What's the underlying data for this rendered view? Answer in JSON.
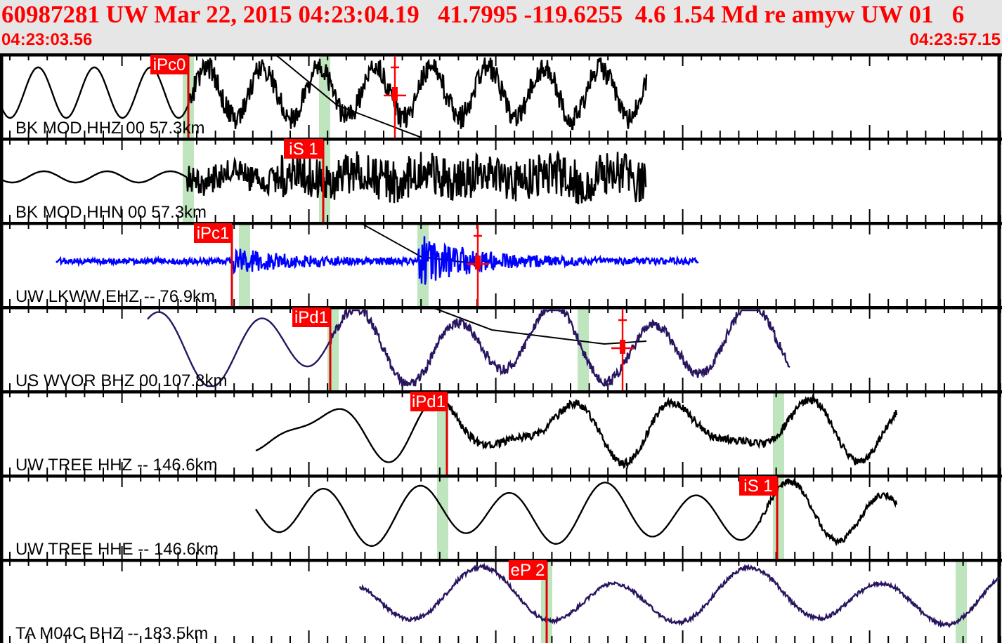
{
  "header": {
    "title": "60987281 UW Mar 22, 2015 04:23:04.19   41.7995 -119.6255  4.6 1.54 Md re amyw UW 01   6",
    "start_time": "04:23:03.56",
    "end_time": "04:23:57.15"
  },
  "traces": [
    {
      "label": "BK MOD HHZ 00 57.3km",
      "color": "#000000",
      "picks": [
        {
          "label": "iPc0"
        }
      ]
    },
    {
      "label": "BK MOD HHN 00 57.3km",
      "color": "#000000",
      "picks": [
        {
          "label": "iS 1"
        }
      ]
    },
    {
      "label": "UW LKWW EHZ -- 76.9km",
      "color": "#0000ff",
      "picks": [
        {
          "label": "iPc1"
        }
      ]
    },
    {
      "label": "US WVOR BHZ 00 107.8km",
      "color": "#2a1660",
      "picks": [
        {
          "label": "iPd1"
        }
      ]
    },
    {
      "label": "UW TREE HHZ -- 146.6km",
      "color": "#000000",
      "picks": [
        {
          "label": "iPd1"
        }
      ]
    },
    {
      "label": "UW TREE HHE -- 146.6km",
      "color": "#000000",
      "picks": [
        {
          "label": "iS 1"
        }
      ]
    },
    {
      "label": "TA M04C BHZ -- 183.5km",
      "color": "#2a1660",
      "picks": [
        {
          "label": "eP 2"
        }
      ]
    }
  ]
}
